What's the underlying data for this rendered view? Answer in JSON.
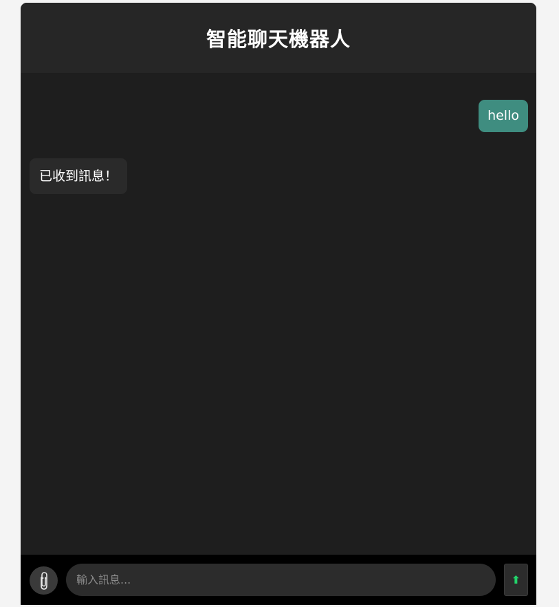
{
  "header": {
    "title": "智能聊天機器人"
  },
  "messages": [
    {
      "role": "user",
      "text": "hello"
    },
    {
      "role": "bot",
      "text": "已收到訊息！"
    }
  ],
  "input": {
    "placeholder": "輸入訊息...",
    "value": ""
  },
  "send": {
    "icon": "up-arrow-icon",
    "glyph": "⬆"
  },
  "attach": {
    "icon": "paperclip-icon"
  },
  "colors": {
    "user_bubble": "#3f8d80",
    "bot_bubble": "#2a2a2a",
    "background": "#1e1e1e",
    "header": "#262626",
    "input_bar": "#000000",
    "send_arrow": "#22d36a"
  }
}
